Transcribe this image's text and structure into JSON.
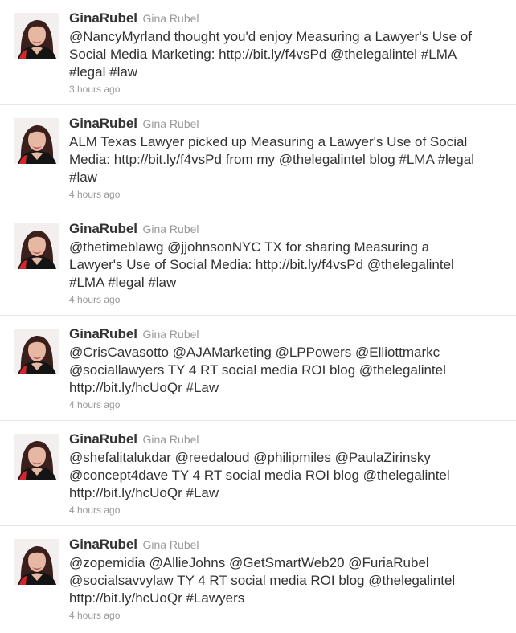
{
  "tweets": [
    {
      "screen_name": "GinaRubel",
      "full_name": "Gina Rubel",
      "lines": [
        "@NancyMyrland thought you'd enjoy Measuring a Lawyer's Use of",
        "Social Media Marketing: http://bit.ly/f4vsPd @thelegalintel #LMA",
        "#legal #law"
      ],
      "timestamp": "3 hours ago"
    },
    {
      "screen_name": "GinaRubel",
      "full_name": "Gina Rubel",
      "lines": [
        "ALM Texas Lawyer picked up Measuring a Lawyer's Use of Social",
        "Media: http://bit.ly/f4vsPd from my @thelegalintel blog #LMA #legal",
        "#law"
      ],
      "timestamp": "4 hours ago"
    },
    {
      "screen_name": "GinaRubel",
      "full_name": "Gina Rubel",
      "lines": [
        "@thetimeblawg @jjohnsonNYC TX for sharing Measuring a",
        "Lawyer's Use of Social Media: http://bit.ly/f4vsPd @thelegalintel",
        "#LMA #legal #law"
      ],
      "timestamp": "4 hours ago"
    },
    {
      "screen_name": "GinaRubel",
      "full_name": "Gina Rubel",
      "lines": [
        "@CrisCavasotto @AJAMarketing @LPPowers @Elliottmarkc",
        "@sociallawyers TY 4 RT social media ROI blog @thelegalintel",
        "http://bit.ly/hcUoQr #Law"
      ],
      "timestamp": "4 hours ago"
    },
    {
      "screen_name": "GinaRubel",
      "full_name": "Gina Rubel",
      "lines": [
        "@shefalitalukdar @reedaloud @philipmiles @PaulaZirinsky",
        "@concept4dave TY 4 RT social media ROI blog @thelegalintel",
        "http://bit.ly/hcUoQr #Law"
      ],
      "timestamp": "4 hours ago"
    },
    {
      "screen_name": "GinaRubel",
      "full_name": "Gina Rubel",
      "lines": [
        "@zopemidia @AllieJohns @GetSmartWeb20 @FuriaRubel",
        "@socialsavvylaw TY 4 RT social media ROI blog @thelegalintel",
        "http://bit.ly/hcUoQr #Lawyers"
      ],
      "timestamp": "4 hours ago"
    }
  ]
}
